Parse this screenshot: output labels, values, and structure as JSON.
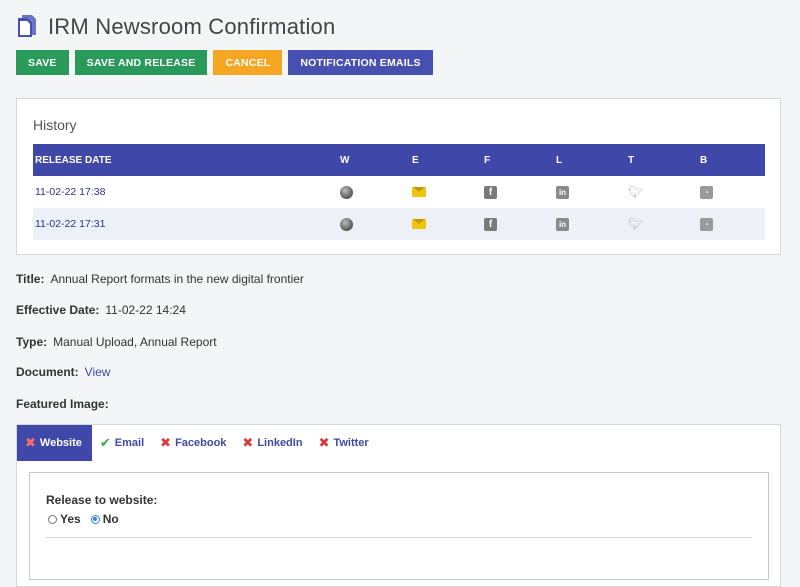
{
  "header": {
    "title": "IRM Newsroom Confirmation"
  },
  "toolbar": {
    "save": "SAVE",
    "save_release": "SAVE AND RELEASE",
    "cancel": "CANCEL",
    "notification_emails": "NOTIFICATION EMAILS"
  },
  "history": {
    "title": "History",
    "columns": [
      "RELEASE DATE",
      "W",
      "E",
      "F",
      "L",
      "T",
      "B"
    ],
    "rows": [
      {
        "date": "11-02-22 17:38"
      },
      {
        "date": "11-02-22 17:31"
      }
    ],
    "icons": [
      "globe-icon",
      "email-icon",
      "facebook-icon",
      "linkedin-icon",
      "twitter-icon",
      "rss-icon"
    ]
  },
  "details": {
    "title_label": "Title:",
    "title_value": "Annual Report formats in the new digital frontier",
    "effective_label": "Effective Date:",
    "effective_value": "11-02-22 14:24",
    "type_label": "Type:",
    "type_value": "Manual Upload, Annual Report",
    "document_label": "Document:",
    "document_link": "View",
    "featured_label": "Featured Image:"
  },
  "tabs": [
    {
      "label": "Website",
      "status": "x",
      "active": true
    },
    {
      "label": "Email",
      "status": "ok",
      "active": false
    },
    {
      "label": "Facebook",
      "status": "x",
      "active": false
    },
    {
      "label": "LinkedIn",
      "status": "x",
      "active": false
    },
    {
      "label": "Twitter",
      "status": "x",
      "active": false
    }
  ],
  "panel": {
    "question": "Release to website:",
    "option_yes": "Yes",
    "option_no": "No",
    "selected": "No"
  },
  "colors": {
    "primary": "#3f48a8",
    "green": "#2a9a5a",
    "orange": "#f5a623"
  }
}
